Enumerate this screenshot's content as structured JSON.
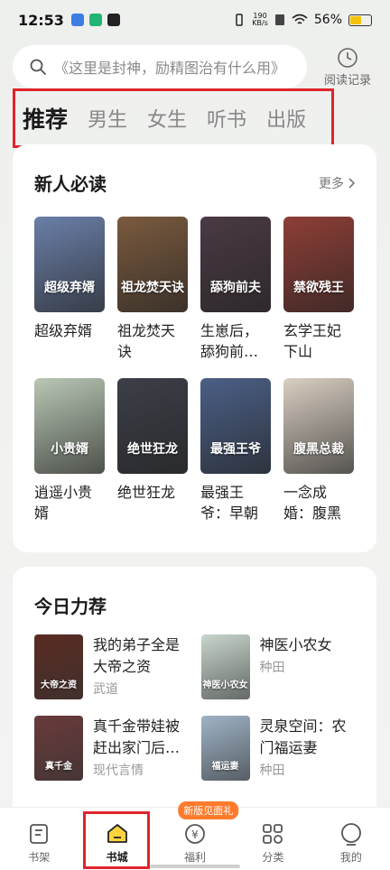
{
  "status_bar": {
    "time": "12:53",
    "speed_value": "190",
    "speed_unit": "KB/s",
    "battery": "56%",
    "battery_level": 0.56
  },
  "search": {
    "placeholder": "《这里是封神，励精图治有什么用》",
    "history_label": "阅读记录"
  },
  "tabs": [
    {
      "label": "推荐",
      "active": true
    },
    {
      "label": "男生"
    },
    {
      "label": "女生"
    },
    {
      "label": "听书"
    },
    {
      "label": "出版"
    }
  ],
  "new_reads": {
    "title": "新人必读",
    "more": "更多",
    "books": [
      {
        "title": "超级弃婿",
        "cover_text": "超级弃婿",
        "color": "#6b7fa8"
      },
      {
        "title": "祖龙焚天诀",
        "cover_text": "祖龙焚天诀",
        "color": "#7a5a3e"
      },
      {
        "title": "生崽后，舔狗前…",
        "cover_text": "舔狗前夫",
        "color": "#4a3a44"
      },
      {
        "title": "玄学王妃下山后，…",
        "cover_text": "禁欲残王",
        "color": "#8e3e36"
      },
      {
        "title": "逍遥小贵婿",
        "cover_text": "小贵婿",
        "color": "#b9c7b4"
      },
      {
        "title": "绝世狂龙",
        "cover_text": "绝世狂龙",
        "color": "#3c3f48"
      },
      {
        "title": "最强王爷：早朝时…",
        "cover_text": "最强王爷",
        "color": "#4b5f86"
      },
      {
        "title": "一念成婚：腹黑总…",
        "cover_text": "腹黑总裁",
        "color": "#d9cfc2"
      }
    ]
  },
  "today": {
    "title": "今日力荐",
    "items": [
      {
        "name": "我的弟子全是大帝之资",
        "genre": "武道",
        "cover_text": "大帝之资",
        "color": "#5a2b22"
      },
      {
        "name": "神医小农女",
        "genre": "种田",
        "cover_text": "神医小农女",
        "color": "#c8d6cc"
      },
      {
        "name": "真千金带娃被赶出家门后…",
        "genre": "现代言情",
        "cover_text": "真千金",
        "color": "#6a3a3a"
      },
      {
        "name": "灵泉空间：农门福运妻",
        "genre": "种田",
        "cover_text": "福运妻",
        "color": "#9fb3c6"
      }
    ]
  },
  "bottom_nav": [
    {
      "label": "书架",
      "icon": "bookshelf-icon"
    },
    {
      "label": "书城",
      "icon": "bookstore-icon",
      "active": true
    },
    {
      "label": "福利",
      "icon": "welfare-icon",
      "badge": "新版见面礼"
    },
    {
      "label": "分类",
      "icon": "category-icon"
    },
    {
      "label": "我的",
      "icon": "profile-icon"
    }
  ]
}
